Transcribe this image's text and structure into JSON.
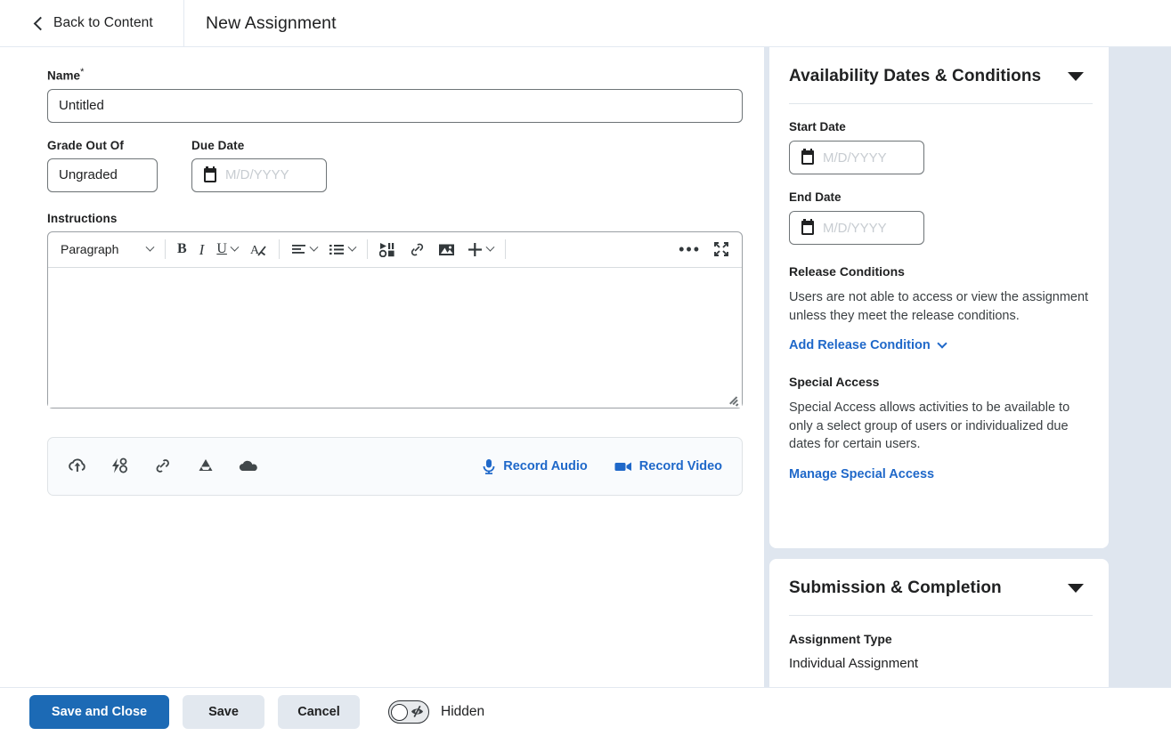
{
  "header": {
    "back_label": "Back to Content",
    "title": "New Assignment"
  },
  "main": {
    "name": {
      "label": "Name",
      "required_marker": "*",
      "value": "Untitled"
    },
    "grade_out_of": {
      "label": "Grade Out Of",
      "value": "Ungraded"
    },
    "due_date": {
      "label": "Due Date",
      "placeholder": "M/D/YYYY",
      "value": ""
    },
    "instructions": {
      "label": "Instructions",
      "value": "",
      "toolbar": {
        "paragraph_style": "Paragraph",
        "bold": "B",
        "italic": "I",
        "underline": "U",
        "clear_formatting": "A",
        "more": "•••"
      }
    },
    "attachments": {
      "record_audio": "Record Audio",
      "record_video": "Record Video"
    }
  },
  "sidebar": {
    "availability": {
      "title": "Availability Dates & Conditions",
      "start_date": {
        "label": "Start Date",
        "placeholder": "M/D/YYYY",
        "value": ""
      },
      "end_date": {
        "label": "End Date",
        "placeholder": "M/D/YYYY",
        "value": ""
      },
      "release_conditions": {
        "heading": "Release Conditions",
        "description": "Users are not able to access or view the assignment unless they meet the release conditions.",
        "link": "Add Release Condition"
      },
      "special_access": {
        "heading": "Special Access",
        "description": "Special Access allows activities to be available to only a select group of users or individualized due dates for certain users.",
        "link": "Manage Special Access"
      }
    },
    "submission": {
      "title": "Submission & Completion",
      "assignment_type_label": "Assignment Type",
      "assignment_type_value": "Individual Assignment"
    }
  },
  "footer": {
    "save_and_close": "Save and Close",
    "save": "Save",
    "cancel": "Cancel",
    "visibility_label": "Hidden",
    "visibility_state": "off"
  },
  "colors": {
    "primary_blue": "#1c6ab5",
    "link_blue": "#1f68c9",
    "sidebar_bg": "#dfe6ef",
    "secondary_btn": "#e2e8ef"
  }
}
